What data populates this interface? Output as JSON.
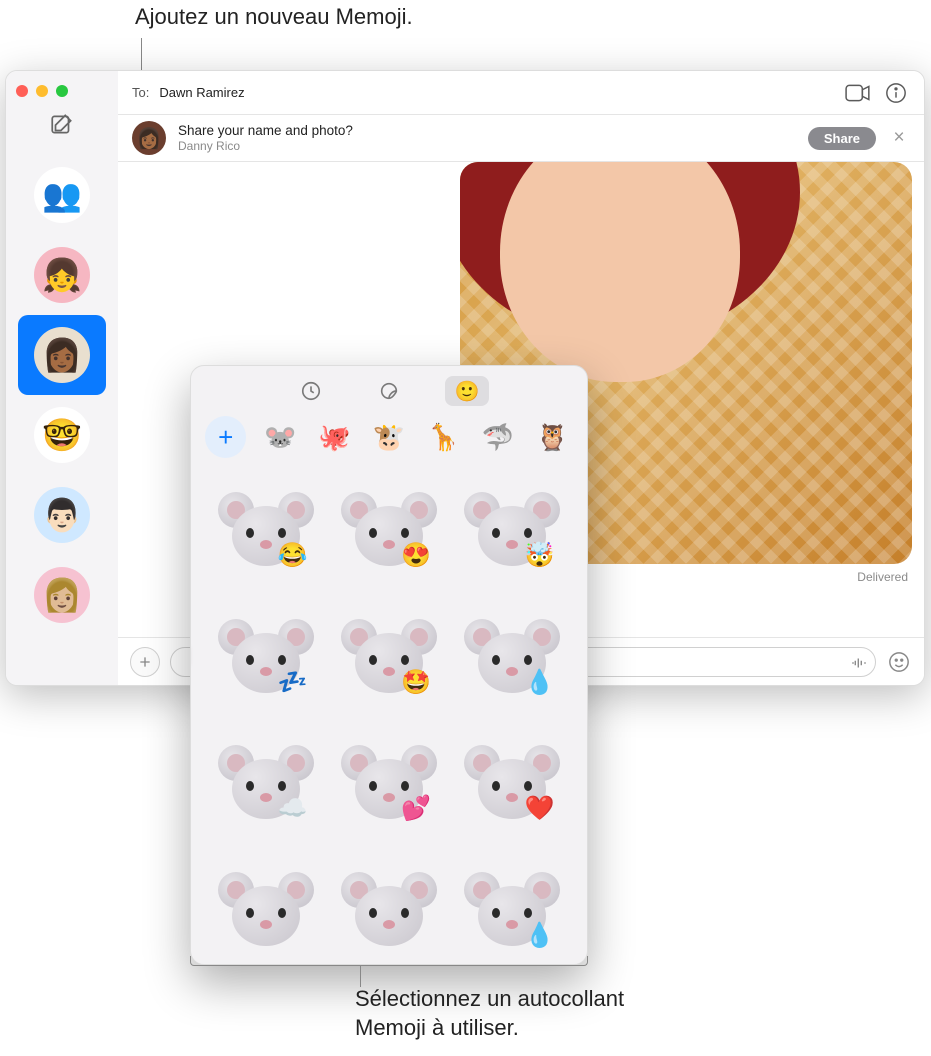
{
  "callouts": {
    "top": "Ajoutez un nouveau Memoji.",
    "bottom_line1": "Sélectionnez un autocollant",
    "bottom_line2": "Memoji à utiliser."
  },
  "window": {
    "to_label": "To:",
    "recipient": "Dawn Ramirez",
    "banner": {
      "title": "Share your name and photo?",
      "subtitle": "Danny Rico",
      "share_button": "Share"
    },
    "delivered": "Delivered"
  },
  "sidebar": {
    "conversations": [
      {
        "emoji": "👥",
        "bg": "#ffffff"
      },
      {
        "emoji": "👧",
        "bg": "#f6b7c2"
      },
      {
        "emoji": "👩🏾",
        "bg": "#e9dfcf",
        "selected": true
      },
      {
        "emoji": "🤓",
        "bg": "#ffffff"
      },
      {
        "emoji": "👨🏻",
        "bg": "#cfe8ff"
      },
      {
        "emoji": "👩🏼",
        "bg": "#f6c2d1"
      }
    ]
  },
  "popover": {
    "tabs": [
      {
        "name": "recents",
        "active": false,
        "icon": "clock"
      },
      {
        "name": "stickers",
        "active": false,
        "icon": "sticker"
      },
      {
        "name": "memoji",
        "active": true,
        "icon": "memoji"
      }
    ],
    "memoji_heads": [
      {
        "name": "add",
        "label": "+"
      },
      {
        "name": "mouse",
        "emoji": "🐭"
      },
      {
        "name": "octopus",
        "emoji": "🐙"
      },
      {
        "name": "cow",
        "emoji": "🐮"
      },
      {
        "name": "giraffe",
        "emoji": "🦒"
      },
      {
        "name": "shark",
        "emoji": "🦈"
      },
      {
        "name": "owl",
        "emoji": "🦉"
      }
    ],
    "stickers": [
      {
        "name": "mouse-tears-joy",
        "overlay": "😂"
      },
      {
        "name": "mouse-heart-eyes",
        "overlay": "😍"
      },
      {
        "name": "mouse-mind-blown",
        "overlay": "🤯"
      },
      {
        "name": "mouse-sleeping",
        "overlay": "💤"
      },
      {
        "name": "mouse-star-eyes",
        "overlay": "🤩"
      },
      {
        "name": "mouse-tear",
        "overlay": "💧"
      },
      {
        "name": "mouse-clouds",
        "overlay": "☁️"
      },
      {
        "name": "mouse-kiss-hearts",
        "overlay": "💕"
      },
      {
        "name": "mouse-hearts",
        "overlay": "❤️"
      },
      {
        "name": "mouse-worried",
        "overlay": ""
      },
      {
        "name": "mouse-angry",
        "overlay": ""
      },
      {
        "name": "mouse-sweat",
        "overlay": "💧"
      }
    ]
  }
}
